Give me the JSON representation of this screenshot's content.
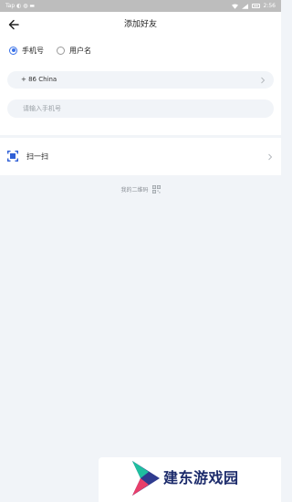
{
  "status_bar": {
    "left_text": "Tap ◐ ◍ ▬",
    "time": "2:56"
  },
  "header": {
    "title": "添加好友"
  },
  "search_type": {
    "options": [
      "手机号",
      "用户名"
    ],
    "selected_index": 0
  },
  "country": {
    "value": "+ 86 China"
  },
  "phone": {
    "placeholder": "请输入手机号",
    "value": ""
  },
  "scan": {
    "label": "扫一扫"
  },
  "qr_link": {
    "label": "我的二维码"
  },
  "watermark": {
    "text": "建东游戏园"
  },
  "colors": {
    "accent": "#3b72e8",
    "background": "#f1f4f8",
    "watermark_text": "#1c2b6b"
  }
}
